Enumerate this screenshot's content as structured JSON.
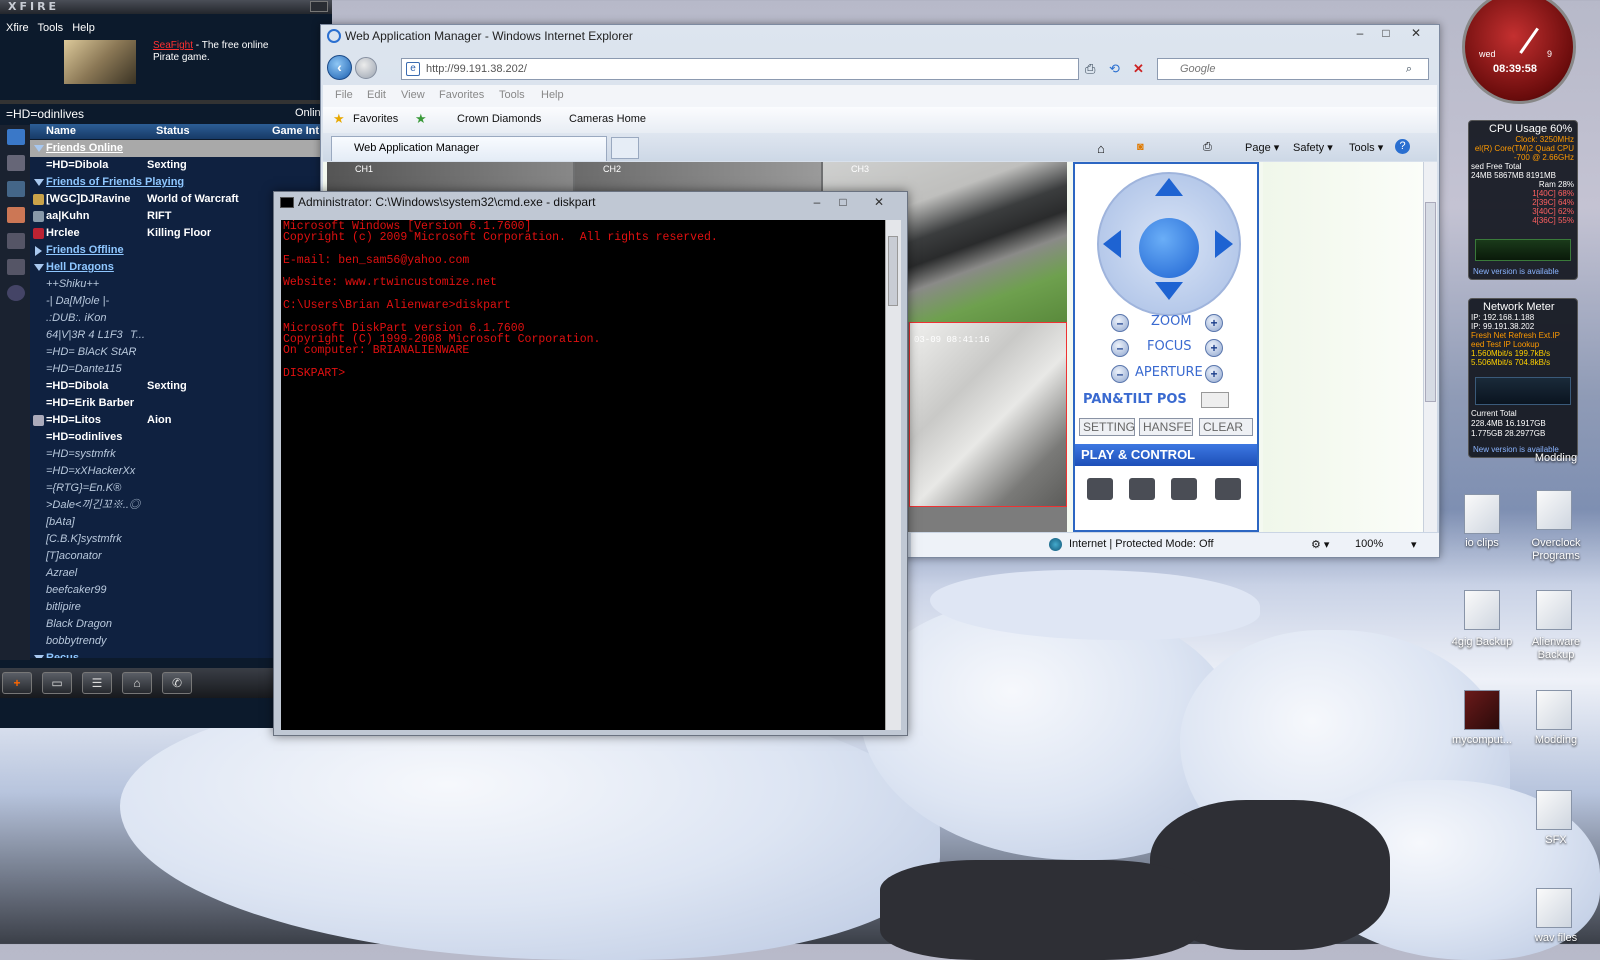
{
  "xfire": {
    "logo": "XFIRE",
    "menu": [
      "Xfire",
      "Tools",
      "Help"
    ],
    "ad": {
      "link": "SeaFight",
      "text": " - The free online Pirate game."
    },
    "user": "=HD=odinlives",
    "status": "Online",
    "columns": {
      "name": "Name",
      "status": "Status",
      "game": "Game Int"
    },
    "groups": {
      "friends_online": "Friends Online",
      "fof_playing": "Friends of Friends Playing",
      "friends_offline": "Friends Offline",
      "hell_dragons": "Hell Dragons",
      "next": "Recus"
    },
    "friends_online": [
      {
        "name": "=HD=Dibola",
        "status": "Sexting"
      }
    ],
    "fof_playing": [
      {
        "name": "[WGC]DJRavine",
        "status": "World of Warcraft"
      },
      {
        "name": "aa|Kuhn",
        "status": "RIFT"
      },
      {
        "name": "Hrclee",
        "status": "Killing Floor"
      }
    ],
    "hell_dragons": [
      {
        "name": "++Shiku++",
        "status": "",
        "online": false
      },
      {
        "name": "-| Da[M]ole |-",
        "status": "",
        "online": false
      },
      {
        "name": ".:DUB:. iKon",
        "status": "",
        "online": false
      },
      {
        "name": "64|V|3R 4 L1F3",
        "status": "T...",
        "online": false
      },
      {
        "name": "=HD= BlAcK StAR",
        "status": "",
        "online": false
      },
      {
        "name": "=HD=Dante115",
        "status": "",
        "online": false
      },
      {
        "name": "=HD=Dibola",
        "status": "Sexting",
        "online": true
      },
      {
        "name": "=HD=Erik Barber",
        "status": "",
        "online": true
      },
      {
        "name": "=HD=Litos",
        "status": "Aion",
        "online": true
      },
      {
        "name": "=HD=odinlives",
        "status": "",
        "online": true
      },
      {
        "name": "=HD=systmfrk",
        "status": "",
        "online": false
      },
      {
        "name": "=HD=xXHackerXx",
        "status": "",
        "online": false
      },
      {
        "name": "={RTG}=En.K®",
        "status": "",
        "online": false
      },
      {
        "name": ">Dale<끼긴꼬※..◎",
        "status": "",
        "online": false
      },
      {
        "name": "[bAta]",
        "status": "",
        "online": false
      },
      {
        "name": "[C.B.K]systmfrk",
        "status": "",
        "online": false
      },
      {
        "name": "[T]aconator",
        "status": "",
        "online": false
      },
      {
        "name": "Azrael",
        "status": "",
        "online": false
      },
      {
        "name": "beefcaker99",
        "status": "",
        "online": false
      },
      {
        "name": "bitlipire",
        "status": "",
        "online": false
      },
      {
        "name": "Black Dragon",
        "status": "",
        "online": false
      },
      {
        "name": "bobbytrendy",
        "status": "",
        "online": false
      }
    ]
  },
  "ie": {
    "title": "Web Application Manager - Windows Internet Explorer",
    "url": "http://99.191.38.202/",
    "search_placeholder": "Google",
    "menu": [
      "File",
      "Edit",
      "View",
      "Favorites",
      "Tools",
      "Help"
    ],
    "favorites": [
      "Favorites",
      "Crown Diamonds",
      "Cameras Home"
    ],
    "tab": "Web Application Manager",
    "commands": [
      "Page ▾",
      "Safety ▾",
      "Tools ▾"
    ],
    "status": "Internet | Protected Mode: Off",
    "zoom": "100%",
    "cameras": {
      "ch1": "CH1",
      "ch2": "CH2",
      "ch3": "CH3",
      "timestamp": "03-09 08:41:16"
    },
    "ptz": {
      "zoom": "ZOOM",
      "focus": "FOCUS",
      "aperture": "APERTURE",
      "pantilt": "PAN&TILT POS",
      "buttons": [
        "SETTING",
        "HANSFE",
        "CLEAR"
      ],
      "play": "PLAY & CONTROL"
    }
  },
  "cmd": {
    "title": "Administrator: C:\\Windows\\system32\\cmd.exe - diskpart",
    "lines": [
      "Microsoft Windows [Version 6.1.7600]",
      "Copyright (c) 2009 Microsoft Corporation.  All rights reserved.",
      "",
      "E-mail: ben_sam56@yahoo.com",
      "",
      "Website: www.rtwincustomize.net",
      "",
      "C:\\Users\\Brian Alienware>diskpart",
      "",
      "Microsoft DiskPart version 6.1.7600",
      "Copyright (C) 1999-2008 Microsoft Corporation.",
      "On computer: BRIANALIENWARE",
      "",
      "DISKPART>"
    ]
  },
  "gadgets": {
    "clock_time": "08:39:58",
    "clock_day": "9",
    "clock_label": "wed",
    "cpu_title": "CPU Usage 60%",
    "cpu_lines": [
      "Clock: 3250MHz",
      "el(R) Core(TM)2 Quad CPU",
      "-700 @ 2.66GHz",
      "sed   Free   Total",
      "24MB 5867MB 8191MB"
    ],
    "cpu_cores": [
      "Ram 28%",
      "1[40C] 68%",
      "2[39C] 64%",
      "3[40C] 62%",
      "4[36C] 55%"
    ],
    "cpu_footer": "New version is available",
    "net_title": "Network Meter",
    "net_lines": [
      "IP: 192.168.1.188",
      "IP: 99.191.38.202",
      "Fresh Net    Refresh Ext.IP",
      "eed Test    IP Lookup",
      "1.560Mbit/s  199.7kB/s",
      "5.506Mbit/s  704.8kB/s"
    ],
    "net_totals": [
      "Current    Total",
      "228.4MB  16.1917GB",
      "1.775GB  28.2977GB"
    ],
    "net_footer": "New version is available"
  },
  "desktop": {
    "icons": [
      "Modding",
      "io clips",
      "Overclock Programs",
      "4gig Backup",
      "Alienware Backup",
      "mycomput...",
      "Modding",
      "SFX",
      "wav files"
    ]
  }
}
